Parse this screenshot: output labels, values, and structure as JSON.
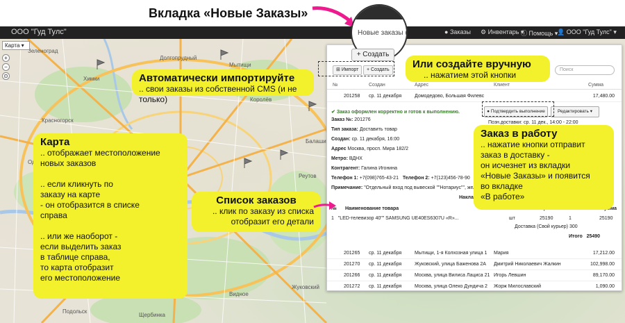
{
  "banner": {
    "title": "Вкладка «Новые Заказы»"
  },
  "navbar": {
    "brand": "ООО \"Гуд Тулс\"",
    "items": [
      "Заказы",
      "Инвентарь",
      "Помощь",
      "ООО \"Гуд Тулс\""
    ]
  },
  "map": {
    "type_select": "Карта",
    "zoom": [
      "+",
      "−",
      "⊙"
    ]
  },
  "magnifier": {
    "tab_label": "Новые заказы (29)",
    "create_label": "+ Создать"
  },
  "panel": {
    "import_label": "Импорт",
    "create_label": "Создать",
    "search_placeholder": "Поиск",
    "columns": [
      "№",
      "Создан",
      "Адрес",
      "Клиент",
      "Сумма"
    ],
    "top_rows": [
      {
        "id": "201258",
        "date": "ср. 11 декабря",
        "address": "Домодедово, Большая Филевс",
        "client": "",
        "sum": "17,480.00"
      }
    ],
    "detail": {
      "status": "Заказ оформлен корректно и готов к выполнению.",
      "confirm_button": "Подтвердить выполнение",
      "edit_button": "Редактировать",
      "delivery_window": "Позн.доставки: ср. 11 дек., 14:00 - 22:00",
      "order_no_label": "Заказ №:",
      "order_no": "201276",
      "order_type_label": "Тип заказа:",
      "order_type": "Доставить товар",
      "created_label": "Создан:",
      "created": "ср. 11 декабря, 16:00",
      "address_label": "Адрес",
      "address": "Москва, просп. Мира 182/2",
      "metro_label": "Метро:",
      "metro": "ВДНХ",
      "contractor_label": "Контрагент:",
      "contractor": "Галина Игонина",
      "phone1_label": "Телефон 1:",
      "phone1": "+7(098)765-43-21",
      "phone2_label": "Телефон 2:",
      "phone2": "+7(123)456-78-90",
      "note_label": "Примечание:",
      "note": "\"Отдельный вход под вывеской \"\"Нотариус\"\", желез",
      "invoice_label": "Наклад",
      "items_columns": [
        "№",
        "Наименование товара",
        "Цена",
        "Кол-во",
        "Сумма"
      ],
      "item": {
        "n": "1",
        "name": "\"LED-телевизор 40\"\" SAMSUNG UE40ES6307U «R»...",
        "unit": "шт",
        "price": "25190",
        "qty": "1",
        "sum": "25190"
      },
      "delivery_line": {
        "label": "Доставка (Свой курьер)",
        "value": "300"
      },
      "total": {
        "label": "Итого",
        "value": "25490"
      }
    },
    "bottom_rows": [
      {
        "id": "201265",
        "date": "ср. 11 декабря",
        "address": "Мытищи, 1-я Колхозная улица 1",
        "client": "Мария",
        "sum": "17,212.00"
      },
      {
        "id": "201270",
        "date": "ср. 11 декабря",
        "address": "Жуковский, улица Баженова 2А",
        "client": "Дмитрий Николаевич Жалкин",
        "sum": "102,998.00"
      },
      {
        "id": "201266",
        "date": "ср. 11 декабря",
        "address": "Москва, улица Вилиса Лациса 21",
        "client": "Игорь Левшин",
        "sum": "89,170.00"
      },
      {
        "id": "201272",
        "date": "ср. 11 декабря",
        "address": "Москва, улица Олеко Дундича 2",
        "client": "Жорж Милославский",
        "sum": "1,090.00"
      }
    ]
  },
  "callouts": {
    "import": {
      "head": "Автоматически импортируйте",
      "text": ".. свои заказы из собственной CMS (и не только)"
    },
    "create": {
      "head": "Или создайте вручную",
      "text": ".. нажатием этой кнопки"
    },
    "map": {
      "head": "Карта",
      "lines": [
        ".. отображает местоположение",
        "новых заказов",
        "",
        ".. если кликнуть по",
        "заказу на карте",
        "- он отобразится в списке",
        "справа",
        "",
        ".. или же наоборот -",
        "если выделить заказ",
        "в таблице справа,",
        "то карта отобразит",
        "его местоположение"
      ]
    },
    "work": {
      "head": "Заказ в работу",
      "lines": [
        ".. нажатие кнопки отправит",
        "заказ в доставку -",
        "он исчезнет из вкладки",
        "«Новые Заказы» и появится",
        "во вкладке",
        "«В работе»"
      ]
    },
    "list": {
      "head": "Список заказов",
      "lines": [
        ".. клик по заказу из списка",
        "отобразит его детали"
      ]
    }
  },
  "map_labels": [
    "Зеленоград",
    "Москва",
    "Химки",
    "Мытищи",
    "Люберцы",
    "Жуковский",
    "Одинцово",
    "Красногорск",
    "Бутово",
    "Реутов",
    "Балашиха",
    "Щербинка",
    "Подольск",
    "Королёв",
    "Долгопрудный",
    "Видное"
  ],
  "colors": {
    "callout": "#f2f12b",
    "arrow": "#ee1b8f",
    "navbar": "#222222",
    "ok": "#3a7d2c"
  }
}
